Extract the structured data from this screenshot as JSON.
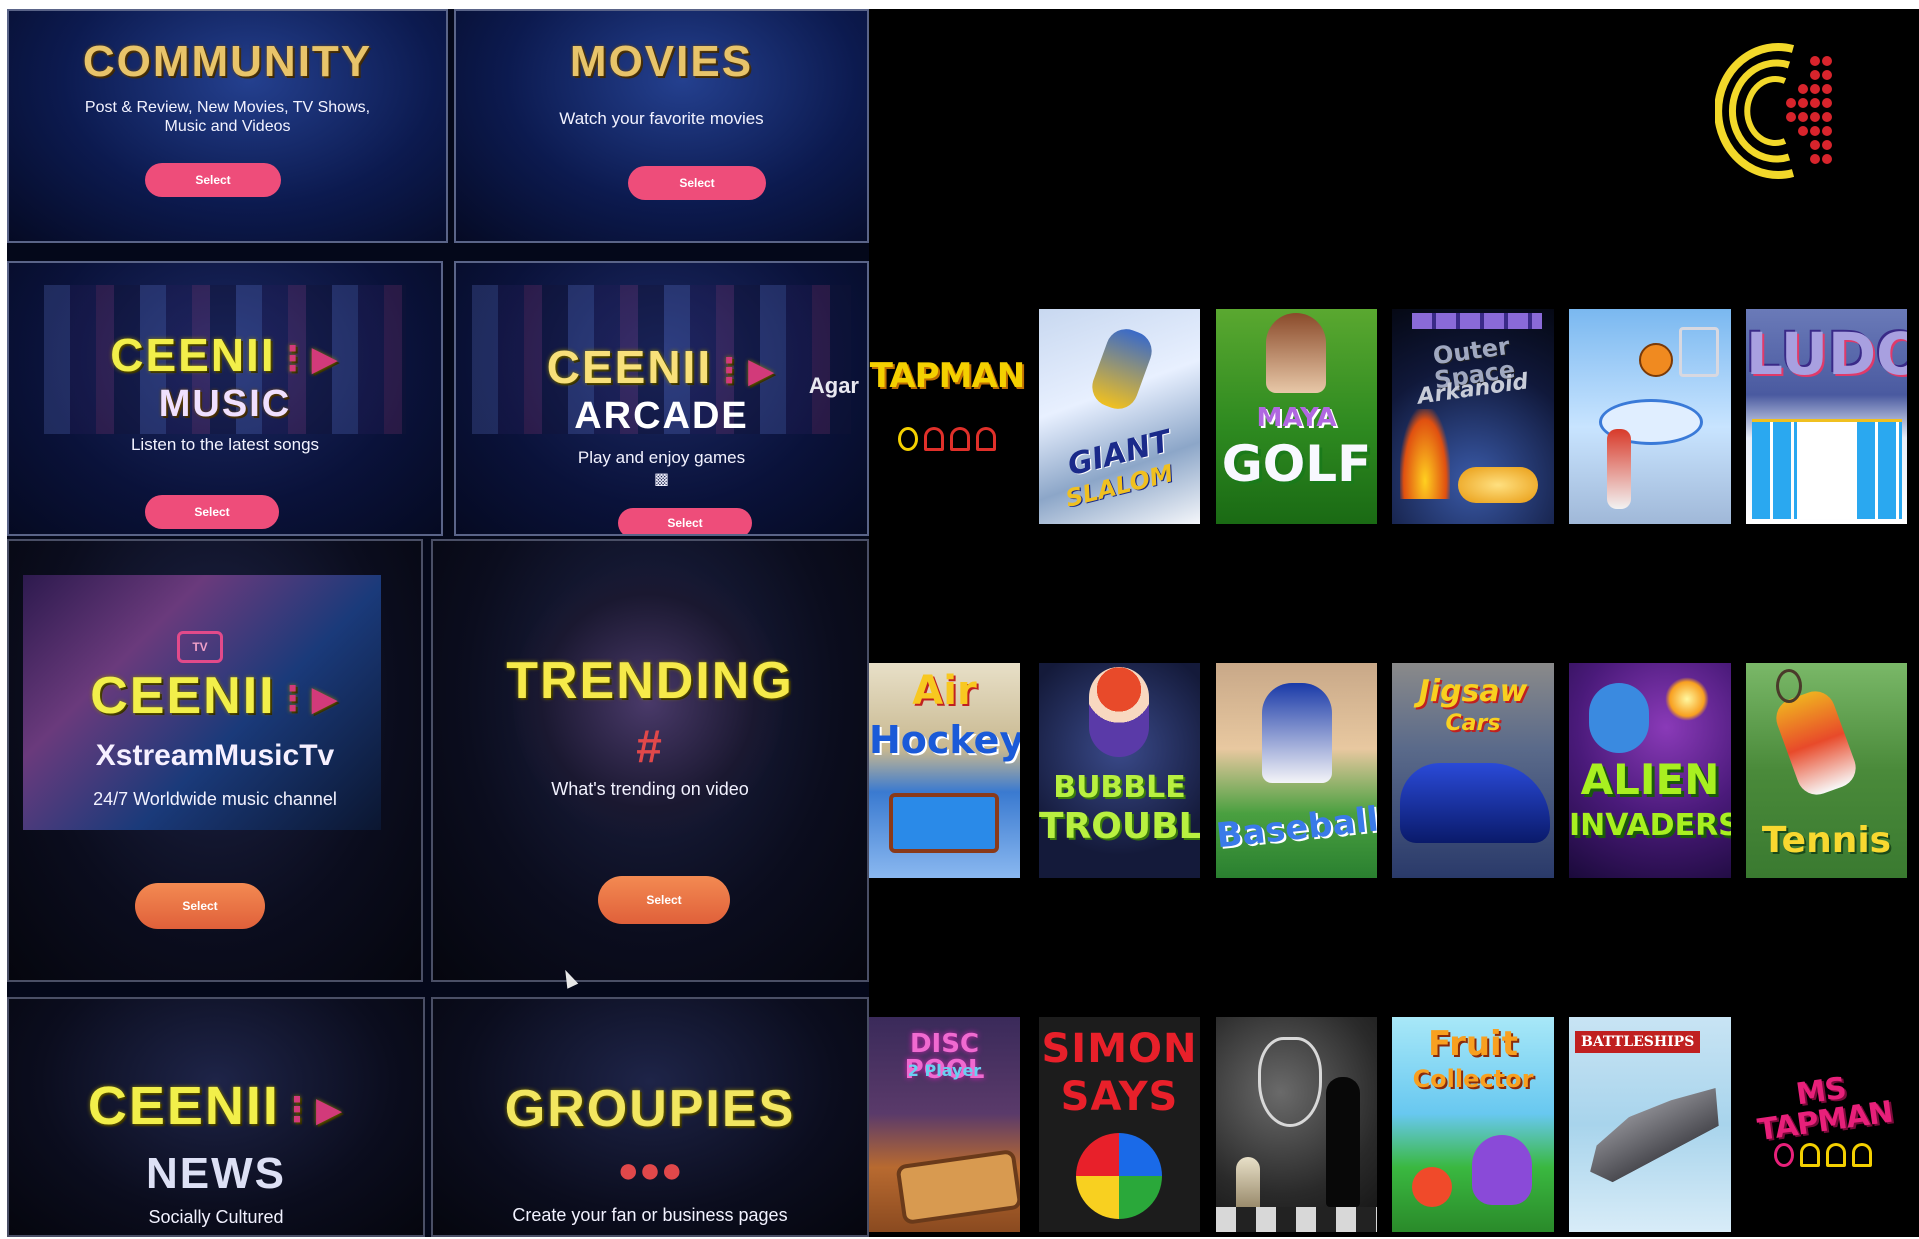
{
  "menu": {
    "community": {
      "title": "Community",
      "subtitle_line1": "Post & Review, New Movies, TV Shows,",
      "subtitle_line2": "Music and Videos",
      "button": "Select"
    },
    "movies": {
      "title": "Movies",
      "subtitle": "Watch your favorite movies",
      "button": "Select"
    },
    "music": {
      "brand": "CEENII",
      "title": "Music",
      "subtitle": "Listen to the latest songs",
      "button": "Select"
    },
    "arcade": {
      "brand": "CEENII",
      "title": "Arcade",
      "subtitle": "Play  and enjoy games",
      "side_text": "Agar",
      "button": "Select"
    },
    "xstream": {
      "brand": "CEENII",
      "tv_badge": "TV",
      "title": "XstreamMusicTv",
      "subtitle": "24/7 Worldwide music channel",
      "button": "Select"
    },
    "trending": {
      "title": "Trending",
      "hashtag": "#",
      "subtitle": "What's trending on video",
      "button": "Select"
    },
    "news": {
      "brand": "CEENII",
      "title": "News",
      "subtitle": "Socially Cultured"
    },
    "groupies": {
      "title": "Groupies",
      "subtitle": "Create your fan or business pages"
    }
  },
  "launcher": {
    "logo_letter": "C",
    "games": [
      {
        "id": "tapman",
        "line1": "TAPMAN",
        "line2": ""
      },
      {
        "id": "giant-slalom",
        "line1": "GIANT",
        "line2": "SLALOM"
      },
      {
        "id": "maya-golf",
        "line1": "MAYA",
        "line2": "GOLF"
      },
      {
        "id": "outer-space-arkanoid",
        "line1": "Outer Space",
        "line2": "Arkanoid"
      },
      {
        "id": "basketball",
        "line1": "",
        "line2": ""
      },
      {
        "id": "ludo",
        "line1": "LUDO",
        "line2": ""
      },
      {
        "id": "air-hockey",
        "line1": "Air",
        "line2": "Hockey"
      },
      {
        "id": "bubble-trouble",
        "line1": "BUBBLE",
        "line2": "TROUBLE"
      },
      {
        "id": "baseball",
        "line1": "Baseball",
        "line2": ""
      },
      {
        "id": "jigsaw-cars",
        "line1": "Jigsaw",
        "line2": "Cars"
      },
      {
        "id": "alien-invaders",
        "line1": "ALIEN",
        "line2": "INVADERS"
      },
      {
        "id": "tennis",
        "line1": "Tennis",
        "line2": ""
      },
      {
        "id": "disc-pool",
        "line1": "DISC POOL",
        "line2": "2 Player"
      },
      {
        "id": "simon-says",
        "line1": "SIMON",
        "line2": "SAYS"
      },
      {
        "id": "chess",
        "line1": "",
        "line2": ""
      },
      {
        "id": "fruit-collector",
        "line1": "Fruit",
        "line2": "Collector"
      },
      {
        "id": "battleships",
        "line1": "BATTLESHIPS",
        "line2": ""
      },
      {
        "id": "ms-tapman",
        "line1": "MS TAPMAN",
        "line2": ""
      }
    ]
  },
  "colors": {
    "select_pink": "#ee4d7a",
    "select_orange": "#e8683e",
    "logo_yellow": "#f2d82a",
    "logo_red": "#d8242c"
  }
}
